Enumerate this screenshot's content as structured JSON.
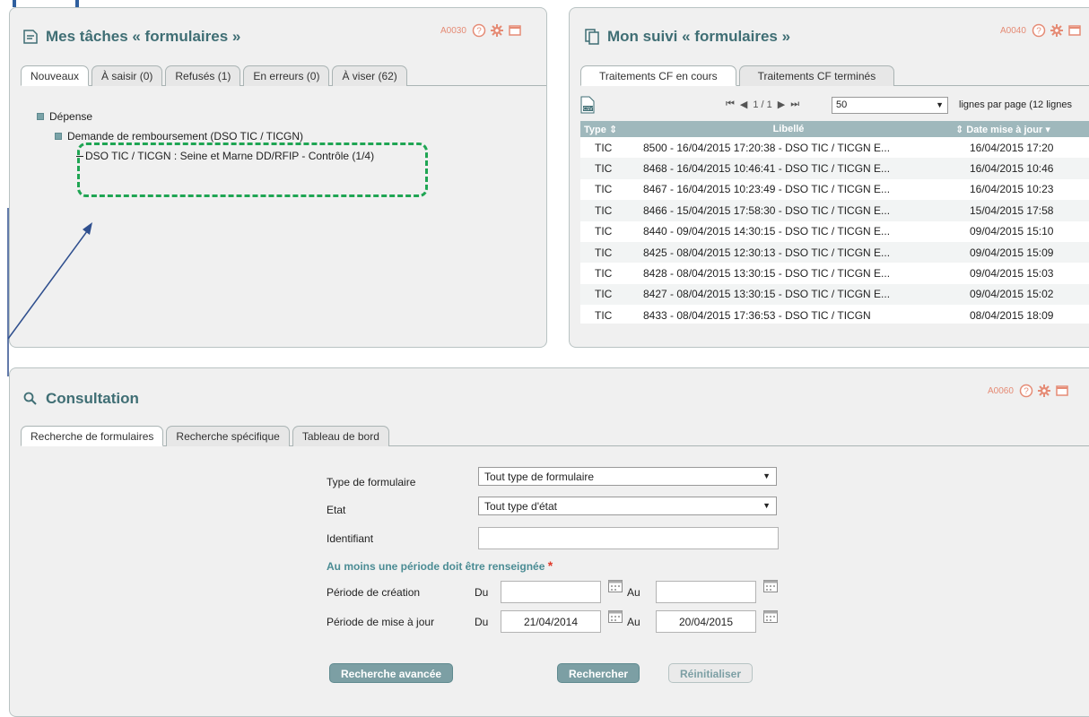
{
  "colors": {
    "title": "#3f6e74",
    "code": "#e58b75",
    "highlight": "#1fa553",
    "grid_header": "#9fb8bc",
    "button": "#7c9fa4",
    "required_star": "#e03a2a"
  },
  "tasks_panel": {
    "title": "Mes tâches « formulaires »",
    "code": "A0030",
    "icons": [
      "help-icon",
      "settings-icon",
      "maximize-icon"
    ],
    "tabs": [
      {
        "label": "Nouveaux",
        "active": true
      },
      {
        "label": "À saisir (0)",
        "active": false
      },
      {
        "label": "Refusés (1)",
        "active": false
      },
      {
        "label": "En erreurs (0)",
        "active": false
      },
      {
        "label": "À viser (62)",
        "active": false
      }
    ],
    "tree": {
      "root": "Dépense",
      "child": "Demande de remboursement (DSO TIC / TICGN)",
      "leaf": "DSO TIC / TICGN : Seine et Marne DD/RFIP - Contrôle (1/4)"
    }
  },
  "tracking_panel": {
    "title": "Mon suivi « formulaires »",
    "code": "A0040",
    "tabs": [
      {
        "label": "Traitements CF en cours",
        "active": true
      },
      {
        "label": "Traitements CF terminés",
        "active": false
      }
    ],
    "pager": {
      "page_text": "1 / 1",
      "page_size": "50",
      "per_page_label": "lignes par page (12 lignes"
    },
    "columns": [
      "Type",
      "Libellé",
      "Date mise à jour"
    ],
    "rows": [
      {
        "type": "TIC",
        "label": "8500 - 16/04/2015 17:20:38 - DSO TIC / TICGN E...",
        "date": "16/04/2015 17:20"
      },
      {
        "type": "TIC",
        "label": "8468 - 16/04/2015 10:46:41 - DSO TIC / TICGN E...",
        "date": "16/04/2015 10:46"
      },
      {
        "type": "TIC",
        "label": "8467 - 16/04/2015 10:23:49 - DSO TIC / TICGN E...",
        "date": "16/04/2015 10:23"
      },
      {
        "type": "TIC",
        "label": "8466 - 15/04/2015 17:58:30 - DSO TIC / TICGN E...",
        "date": "15/04/2015 17:58"
      },
      {
        "type": "TIC",
        "label": "8440 - 09/04/2015 14:30:15 - DSO TIC / TICGN E...",
        "date": "09/04/2015 15:10"
      },
      {
        "type": "TIC",
        "label": "8425 - 08/04/2015 12:30:13 - DSO TIC / TICGN E...",
        "date": "09/04/2015 15:09"
      },
      {
        "type": "TIC",
        "label": "8428 - 08/04/2015 13:30:15 - DSO TIC / TICGN E...",
        "date": "09/04/2015 15:03"
      },
      {
        "type": "TIC",
        "label": "8427 - 08/04/2015 13:30:15 - DSO TIC / TICGN E...",
        "date": "09/04/2015 15:02"
      },
      {
        "type": "TIC",
        "label": "8433 - 08/04/2015 17:36:53 - DSO TIC / TICGN",
        "date": "08/04/2015 18:09"
      }
    ]
  },
  "consultation_panel": {
    "title": "Consultation",
    "code": "A0060",
    "tabs": [
      {
        "label": "Recherche de formulaires",
        "active": true
      },
      {
        "label": "Recherche spécifique",
        "active": false
      },
      {
        "label": "Tableau de bord",
        "active": false
      }
    ],
    "form": {
      "type_label": "Type de formulaire",
      "type_value": "Tout type de formulaire",
      "etat_label": "Etat",
      "etat_value": "Tout type d'état",
      "identifiant_label": "Identifiant",
      "identifiant_value": "",
      "required_note": "Au moins une période doit être renseignée",
      "required_star": "*",
      "creation_label": "Période de création",
      "maj_label": "Période de mise à jour",
      "du_label": "Du",
      "au_label": "Au",
      "creation_from": "",
      "creation_to": "",
      "maj_from": "21/04/2014",
      "maj_to": "20/04/2015"
    },
    "buttons": {
      "advanced": "Recherche avancée",
      "search": "Rechercher",
      "reset": "Réinitialiser"
    }
  }
}
